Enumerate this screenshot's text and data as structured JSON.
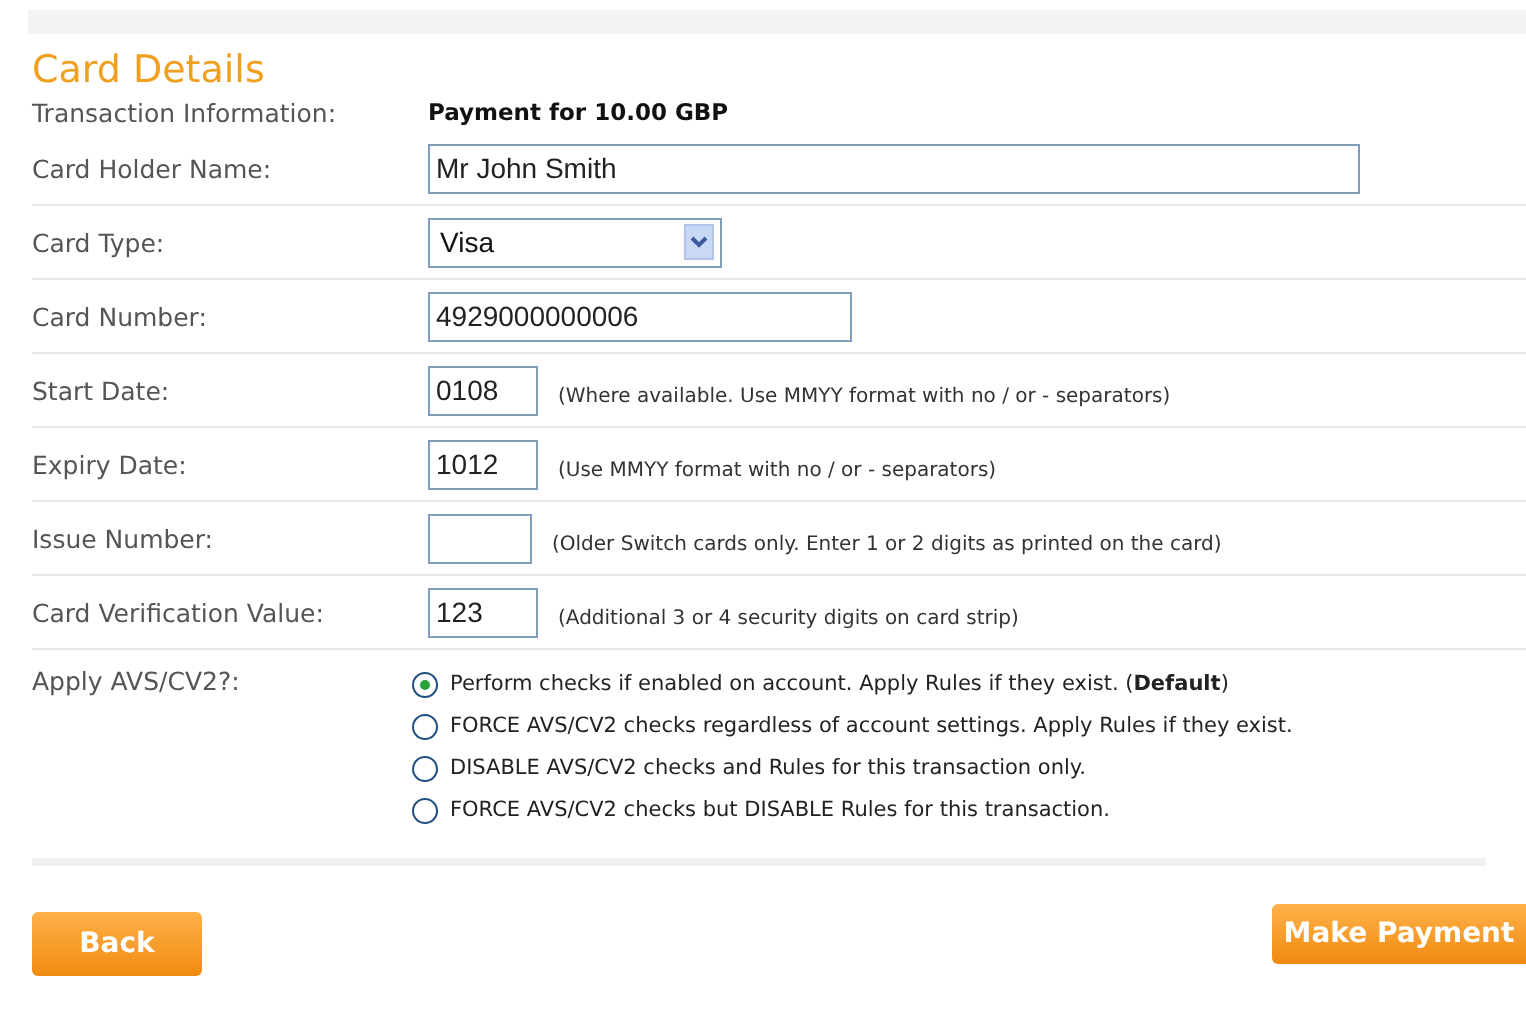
{
  "heading": "Card Details",
  "transaction": {
    "label": "Transaction Information:",
    "value": "Payment for 10.00 GBP"
  },
  "fields": [
    {
      "kind": "text",
      "label": "Card Holder Name:",
      "value": "Mr John Smith"
    },
    {
      "kind": "select",
      "label": "Card Type:",
      "value": "Visa"
    },
    {
      "kind": "text",
      "label": "Card Number:",
      "value": "4929000000006"
    },
    {
      "kind": "text",
      "label": "Start Date:",
      "value": "0108",
      "hint": "(Where available. Use MMYY format with no / or - separators)"
    },
    {
      "kind": "text",
      "label": "Expiry Date:",
      "value": "1012",
      "hint": "(Use MMYY format with no / or - separators)"
    },
    {
      "kind": "text",
      "label": "Issue Number:",
      "hint": "(Older Switch cards only. Enter 1 or 2 digits as printed on the card)"
    },
    {
      "kind": "text",
      "label": "Card Verification Value:",
      "value": "123",
      "hint": "(Additional 3 or 4 security digits on card strip)"
    }
  ],
  "avs": {
    "label": "Apply AVS/CV2?:",
    "options": [
      {
        "text": "Perform checks if enabled on account. Apply Rules if they exist. (**Default**)",
        "selected": true
      },
      {
        "text": "FORCE AVS/CV2 checks regardless of account settings. Apply Rules if they exist.",
        "selected": false
      },
      {
        "text": "DISABLE AVS/CV2 checks and Rules for this transaction only.",
        "selected": false
      },
      {
        "text": "FORCE AVS/CV2 checks but DISABLE Rules for this transaction.",
        "selected": false
      }
    ]
  },
  "buttons": {
    "back": "Back",
    "submit": "Make Payment"
  }
}
